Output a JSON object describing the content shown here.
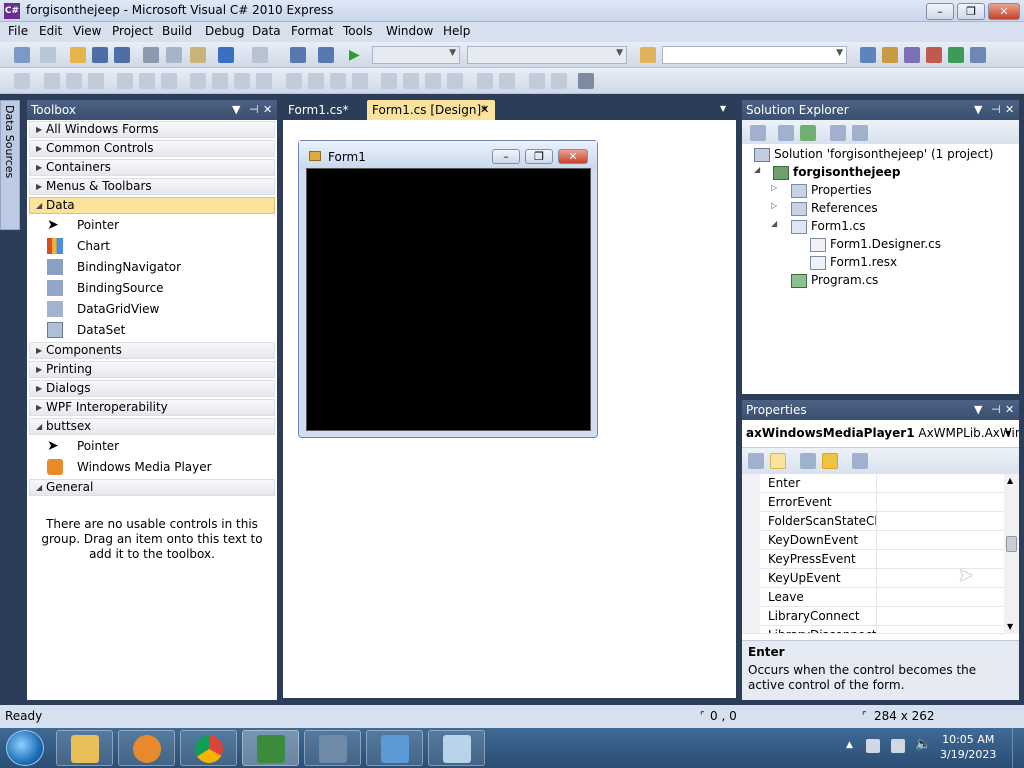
{
  "window": {
    "title": "forgisonthejeep - Microsoft Visual C# 2010 Express",
    "icon_text": "C#",
    "minimize": "–",
    "maximize": "❐",
    "close": "✕"
  },
  "menu": [
    "File",
    "Edit",
    "View",
    "Project",
    "Build",
    "Debug",
    "Data",
    "Format",
    "Tools",
    "Window",
    "Help"
  ],
  "side_tab": {
    "label": "Data Sources"
  },
  "toolbox": {
    "title": "Toolbox",
    "groups": [
      {
        "label": "All Windows Forms"
      },
      {
        "label": "Common Controls"
      },
      {
        "label": "Containers"
      },
      {
        "label": "Menus & Toolbars"
      },
      {
        "label": "Data",
        "items": [
          "Pointer",
          "Chart",
          "BindingNavigator",
          "BindingSource",
          "DataGridView",
          "DataSet"
        ]
      },
      {
        "label": "Components"
      },
      {
        "label": "Printing"
      },
      {
        "label": "Dialogs"
      },
      {
        "label": "WPF Interoperability"
      },
      {
        "label": "buttsex",
        "items": [
          "Pointer",
          "Windows Media Player"
        ]
      },
      {
        "label": "General"
      }
    ],
    "empty_message": "There are no usable controls in this group. Drag an item onto this text to add it to the toolbox."
  },
  "tabs": [
    {
      "label": "Form1.cs*"
    },
    {
      "label": "Form1.cs [Design]*",
      "close": "✕"
    }
  ],
  "designer": {
    "form_title": "Form1"
  },
  "solution_explorer": {
    "title": "Solution Explorer",
    "nodes": [
      {
        "label": "Solution 'forgisonthejeep' (1 project)"
      },
      {
        "label": "forgisonthejeep"
      },
      {
        "label": "Properties"
      },
      {
        "label": "References"
      },
      {
        "label": "Form1.cs"
      },
      {
        "label": "Form1.Designer.cs"
      },
      {
        "label": "Form1.resx"
      },
      {
        "label": "Program.cs"
      }
    ]
  },
  "properties": {
    "title": "Properties",
    "object_name": "axWindowsMediaPlayer1",
    "object_type": "AxWMPLib.AxWindo",
    "rows": [
      "Enter",
      "ErrorEvent",
      "FolderScanStateCha",
      "KeyDownEvent",
      "KeyPressEvent",
      "KeyUpEvent",
      "Leave",
      "LibraryConnect",
      "LibraryDisconnect"
    ],
    "desc_title": "Enter",
    "desc_text": "Occurs when the control becomes the active control of the form."
  },
  "status": {
    "left": "Ready",
    "position": "0 , 0",
    "size": "284 x 262"
  },
  "taskbar": {
    "time": "10:05 AM",
    "date": "3/19/2023"
  },
  "colors": {
    "accent": "#3b5070",
    "selected_group": "#fbe39e"
  }
}
